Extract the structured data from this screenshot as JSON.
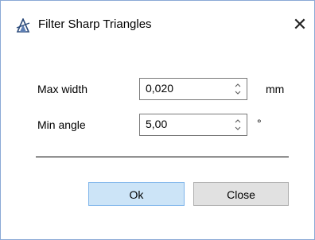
{
  "window": {
    "title": "Filter Sharp Triangles",
    "close_glyph": "✕",
    "app_icon": "triangle-pen-icon"
  },
  "fields": {
    "max_width": {
      "label": "Max width",
      "value": "0,020",
      "unit": "mm"
    },
    "min_angle": {
      "label": "Min angle",
      "value": "5,00",
      "unit": "°"
    }
  },
  "buttons": {
    "ok_label": "Ok",
    "close_label": "Close"
  },
  "colors": {
    "ok_bg": "#cce4f7",
    "ok_border": "#7eb4ea",
    "button_bg": "#e1e1e1",
    "window_border": "#8aa9d6"
  }
}
